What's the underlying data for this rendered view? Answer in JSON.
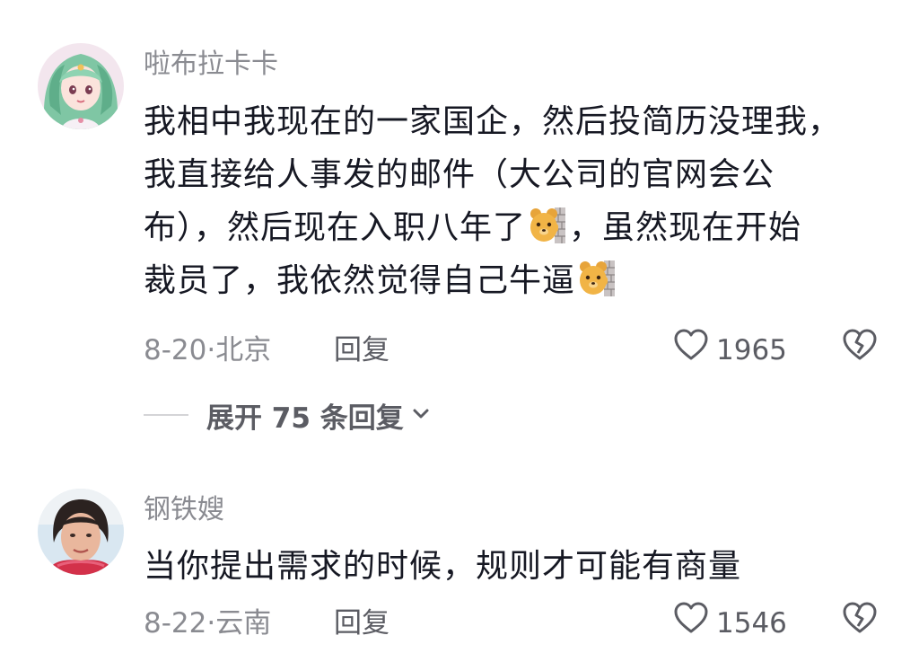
{
  "comments": [
    {
      "username": "啦布拉卡卡",
      "lines": [
        "我相中我现在的一家国企，然后投简历没理我，",
        "我直接给人事发的邮件（大公司的官网会公",
        "布），然后现在入职八年了",
        "，虽然现在开始",
        "裁员了，我依然觉得自己牛逼"
      ],
      "date_location": "8-20·北京",
      "reply_label": "回复",
      "like_count": "1965",
      "emoji_name": "bear-peeking-from-wall-emoji",
      "avatar_name": "anime-girl-avatar"
    },
    {
      "username": "钢铁嫂",
      "lines": [
        "当你提出需求的时候，规则才可能有商量"
      ],
      "date_location": "8-22·云南",
      "reply_label": "回复",
      "like_count": "1546",
      "avatar_name": "woman-photo-avatar"
    }
  ],
  "expand_replies": {
    "label": "展开 75 条回复"
  },
  "colors": {
    "text_primary": "#161823",
    "text_secondary": "#8a8b91",
    "divider": "#d4d4d7"
  }
}
